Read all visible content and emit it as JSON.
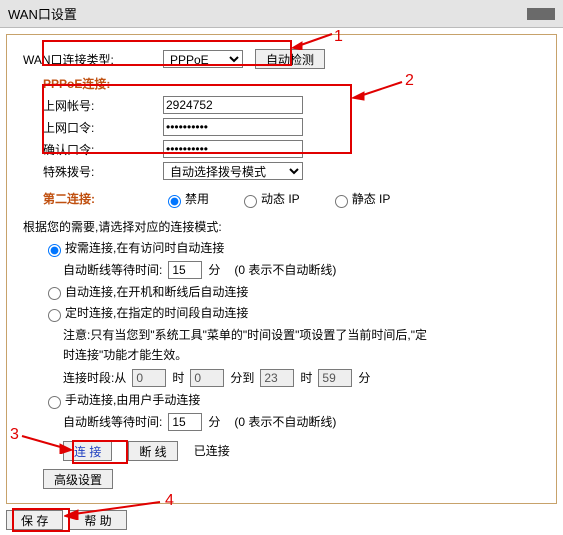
{
  "window": {
    "title": "WAN口设置"
  },
  "anno": {
    "n1": "1",
    "n2": "2",
    "n3": "3",
    "n4": "4"
  },
  "wan": {
    "type_label": "WAN口连接类型:",
    "type_value": "PPPoE",
    "detect_btn": "自动检测"
  },
  "pppoe": {
    "title": "PPPoE连接:",
    "user_label": "上网帐号:",
    "user_value": "2924752",
    "pass_label": "上网口令:",
    "pass_value": "••••••••••",
    "confirm_label": "确认口令:",
    "confirm_value": "••••••••••",
    "dial_label": "特殊拨号:",
    "dial_value": "自动选择拨号模式"
  },
  "second": {
    "title": "第二连接:",
    "opt_disable": "禁用",
    "opt_dyn": "动态 IP",
    "opt_static": "静态 IP"
  },
  "mode": {
    "intro": "根据您的需要,请选择对应的连接模式:",
    "on_demand": "按需连接,在有访问时自动连接",
    "auto_wait_label": "自动断线等待时间:",
    "auto_wait_value": "15",
    "unit_min": "分",
    "hint_zero": "(0 表示不自动断线)",
    "auto_connect": "自动连接,在开机和断线后自动连接",
    "timed_connect": "定时连接,在指定的时间段自动连接",
    "note_line1": "注意:只有当您到\"系统工具\"菜单的\"时间设置\"项设置了当前时间后,\"定",
    "note_line2": "时连接\"功能才能生效。",
    "period_label": "连接时段:从",
    "from_h": "0",
    "from_m": "0",
    "to_label": "分到",
    "to_h": "23",
    "to_m": "59",
    "unit_hour": "时",
    "manual_connect": "手动连接,由用户手动连接",
    "auto_wait_value2": "15"
  },
  "actions": {
    "connect": "连 接",
    "disconnect": "断 线",
    "status": "已连接",
    "advanced": "高级设置",
    "save": "保 存",
    "help": "帮 助"
  }
}
